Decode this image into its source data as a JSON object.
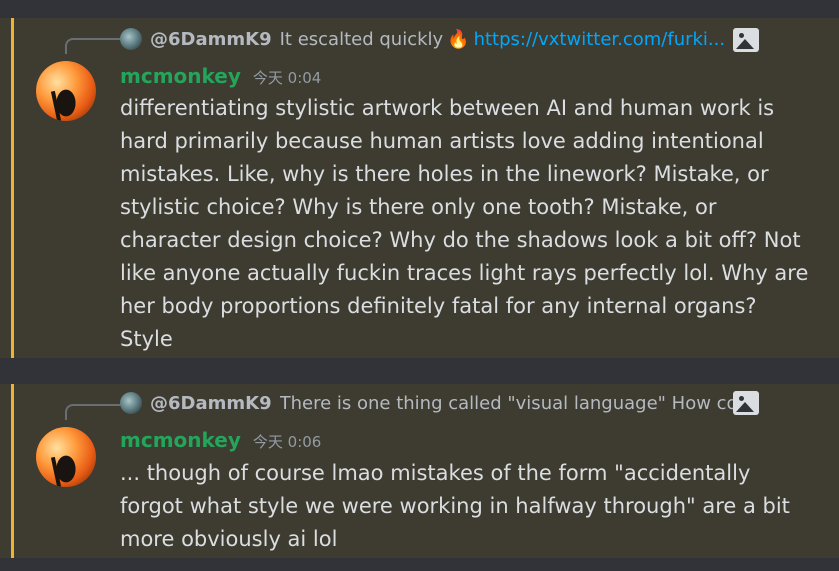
{
  "messages": [
    {
      "reply": {
        "author": "@6DammK9",
        "text": "It escalted quickly",
        "emoji": "🔥",
        "link": "https://vxtwitter.com/furki..."
      },
      "author": "mcmonkey",
      "timestamp": "今天 0:04",
      "content": "differentiating stylistic artwork between AI and human work is hard primarily because human artists love adding intentional mistakes. Like, why is there holes in the linework? Mistake, or stylistic choice? Why is there only one tooth? Mistake, or character design choice? Why do the shadows look a bit off? Not like anyone actually fuckin traces light rays perfectly lol. Why are her body proportions definitely fatal for any internal organs? Style"
    },
    {
      "reply": {
        "author": "@6DammK9",
        "text": "There is one thing called \"visual language\" How co..."
      },
      "author": "mcmonkey",
      "timestamp": "今天 0:06",
      "content": "... though of course lmao mistakes of the form \"accidentally forgot what style we were working in halfway through\" are a bit more obviously ai lol"
    }
  ],
  "icons": {
    "image_attachment": "image-icon"
  },
  "colors": {
    "background": "#313338",
    "highlight_bg": "#3e3b31",
    "mention_bar": "#f0b232",
    "username": "#23a55a",
    "link": "#00a8fc"
  }
}
